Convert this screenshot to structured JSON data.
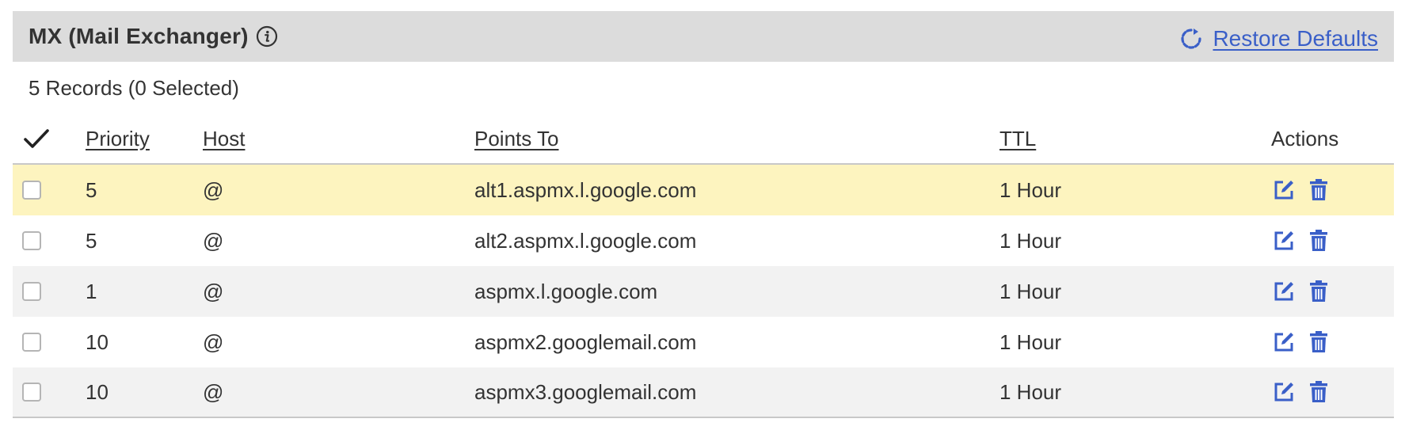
{
  "section": {
    "title": "MX (Mail Exchanger)",
    "restore_label": "Restore Defaults",
    "record_count": "5 Records (0 Selected)"
  },
  "table": {
    "columns": {
      "priority": "Priority",
      "host": "Host",
      "points_to": "Points To",
      "ttl": "TTL",
      "actions": "Actions"
    },
    "rows": [
      {
        "priority": "5",
        "host": "@",
        "points_to": "alt1.aspmx.l.google.com",
        "ttl": "1 Hour"
      },
      {
        "priority": "5",
        "host": "@",
        "points_to": "alt2.aspmx.l.google.com",
        "ttl": "1 Hour"
      },
      {
        "priority": "1",
        "host": "@",
        "points_to": "aspmx.l.google.com",
        "ttl": "1 Hour"
      },
      {
        "priority": "10",
        "host": "@",
        "points_to": "aspmx2.googlemail.com",
        "ttl": "1 Hour"
      },
      {
        "priority": "10",
        "host": "@",
        "points_to": "aspmx3.googlemail.com",
        "ttl": "1 Hour"
      }
    ]
  },
  "icons": {
    "info": "info-icon",
    "restore": "refresh-icon",
    "select_all": "checkmark-icon",
    "edit": "edit-icon",
    "delete": "trash-icon"
  },
  "colors": {
    "header_bg": "#dcdcdc",
    "link": "#3a5fc8",
    "highlight_row": "#fdf4bf",
    "alt_row": "#f2f2f2",
    "action_icon": "#3a5fc8"
  }
}
